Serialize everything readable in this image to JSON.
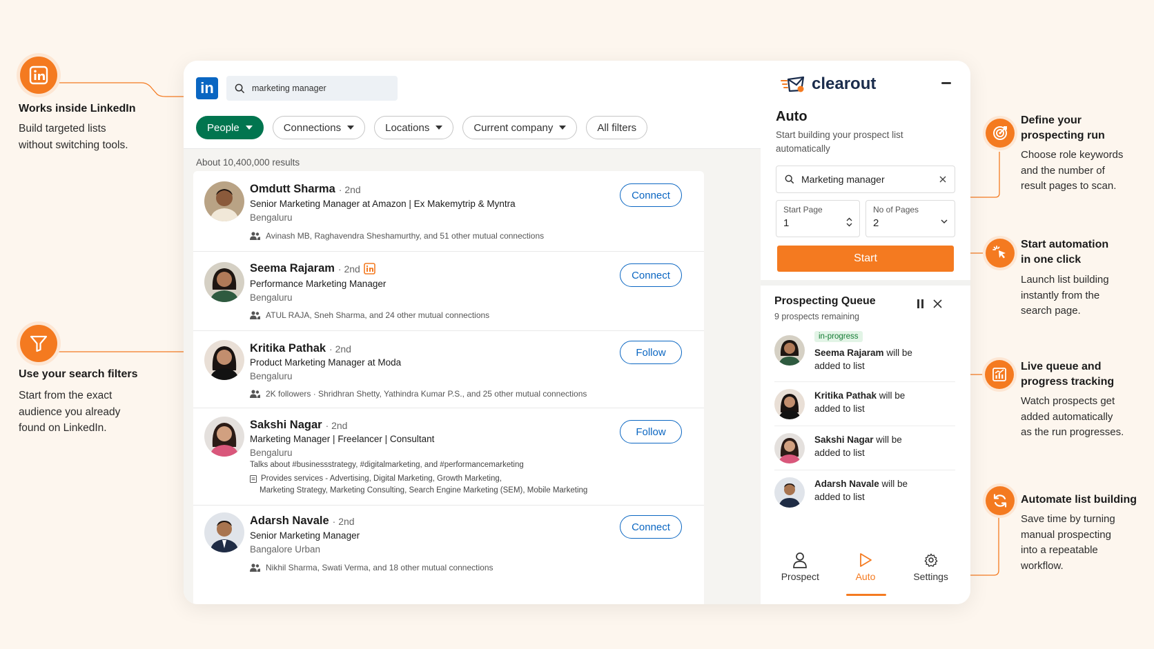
{
  "left_callouts": [
    {
      "title": "Works inside LinkedIn",
      "desc1": "Build targeted lists",
      "desc2": "without switching tools."
    },
    {
      "title": "Use your search filters",
      "desc1": "Start from the exact",
      "desc2": "audience you already",
      "desc3": "found on LinkedIn."
    }
  ],
  "linkedin": {
    "logo": "in",
    "search_value": "marketing manager",
    "filters": [
      "People",
      "Connections",
      "Locations",
      "Current company",
      "All filters"
    ],
    "results_count": "About 10,400,000 results",
    "results": [
      {
        "name": "Omdutt Sharma",
        "degree": "· 2nd",
        "headline": "Senior Marketing Manager at Amazon | Ex Makemytrip & Myntra",
        "location": "Bengaluru",
        "mutual": "Avinash MB, Raghavendra Sheshamurthy, and 51 other mutual connections",
        "action": "Connect"
      },
      {
        "name": "Seema Rajaram",
        "degree": "· 2nd",
        "headline": "Performance Marketing Manager",
        "location": "Bengaluru",
        "mutual": "ATUL RAJA, Sneh Sharma, and 24 other mutual connections",
        "action": "Connect"
      },
      {
        "name": "Kritika Pathak",
        "degree": "· 2nd",
        "headline": "Product Marketing Manager at Moda",
        "location": "Bengaluru",
        "mutual": "2K followers · Shridhran Shetty, Yathindra Kumar P.S., and 25 other mutual connections",
        "action": "Follow"
      },
      {
        "name": "Sakshi Nagar",
        "degree": "· 2nd",
        "headline": "Marketing Manager | Freelancer | Consultant",
        "location": "Bengaluru",
        "talks": "Talks about #businessstrategy, #digitalmarketing, and #performancemarketing",
        "services1": "Provides services - Advertising, Digital Marketing, Growth Marketing,",
        "services2": "Marketing Strategy, Marketing Consulting, Search Engine Marketing (SEM), Mobile Marketing",
        "action": "Follow"
      },
      {
        "name": "Adarsh Navale",
        "degree": "· 2nd",
        "headline": "Senior Marketing Manager",
        "location": "Bangalore Urban",
        "mutual": "Nikhil Sharma, Swati Verma, and 18 other mutual connections",
        "action": "Connect"
      }
    ]
  },
  "clearout": {
    "brand": "clearout",
    "mode_title": "Auto",
    "mode_sub": "Start building your prospect list automatically",
    "search_value": "Marketing manager",
    "start_page_label": "Start Page",
    "start_page_value": "1",
    "pages_label": "No of Pages",
    "pages_value": "2",
    "start_button": "Start",
    "queue_title": "Prospecting Queue",
    "queue_sub": "9 prospects remaining",
    "queue": [
      {
        "badge": "in-progress",
        "name": "Seema Rajaram",
        "text1": " will be",
        "text2": "added to list"
      },
      {
        "name": "Kritika Pathak",
        "text1": " will be",
        "text2": "added to list"
      },
      {
        "name": "Sakshi Nagar",
        "text1": " will be",
        "text2": "added to list"
      },
      {
        "name": "Adarsh Navale",
        "text1": " will be",
        "text2": "added to list"
      }
    ],
    "tabs": [
      "Prospect",
      "Auto",
      "Settings"
    ],
    "active_tab": "Auto",
    "accent": "#f47a20"
  },
  "right_callouts": [
    {
      "t1": "Define your",
      "t2": "prospecting run",
      "d": [
        "Choose role keywords",
        "and the number of",
        "result pages to scan."
      ]
    },
    {
      "t1": "Start automation",
      "t2": "in one click",
      "d": [
        "Launch list building",
        "instantly from the",
        "search page."
      ]
    },
    {
      "t1": "Live queue and",
      "t2": "progress tracking",
      "d": [
        "Watch prospects get",
        "added automatically",
        "as the run progresses."
      ]
    },
    {
      "t1": "Automate list building",
      "t2": "",
      "d": [
        "Save time by turning",
        "manual prospecting",
        "into a repeatable",
        "workflow."
      ]
    }
  ]
}
